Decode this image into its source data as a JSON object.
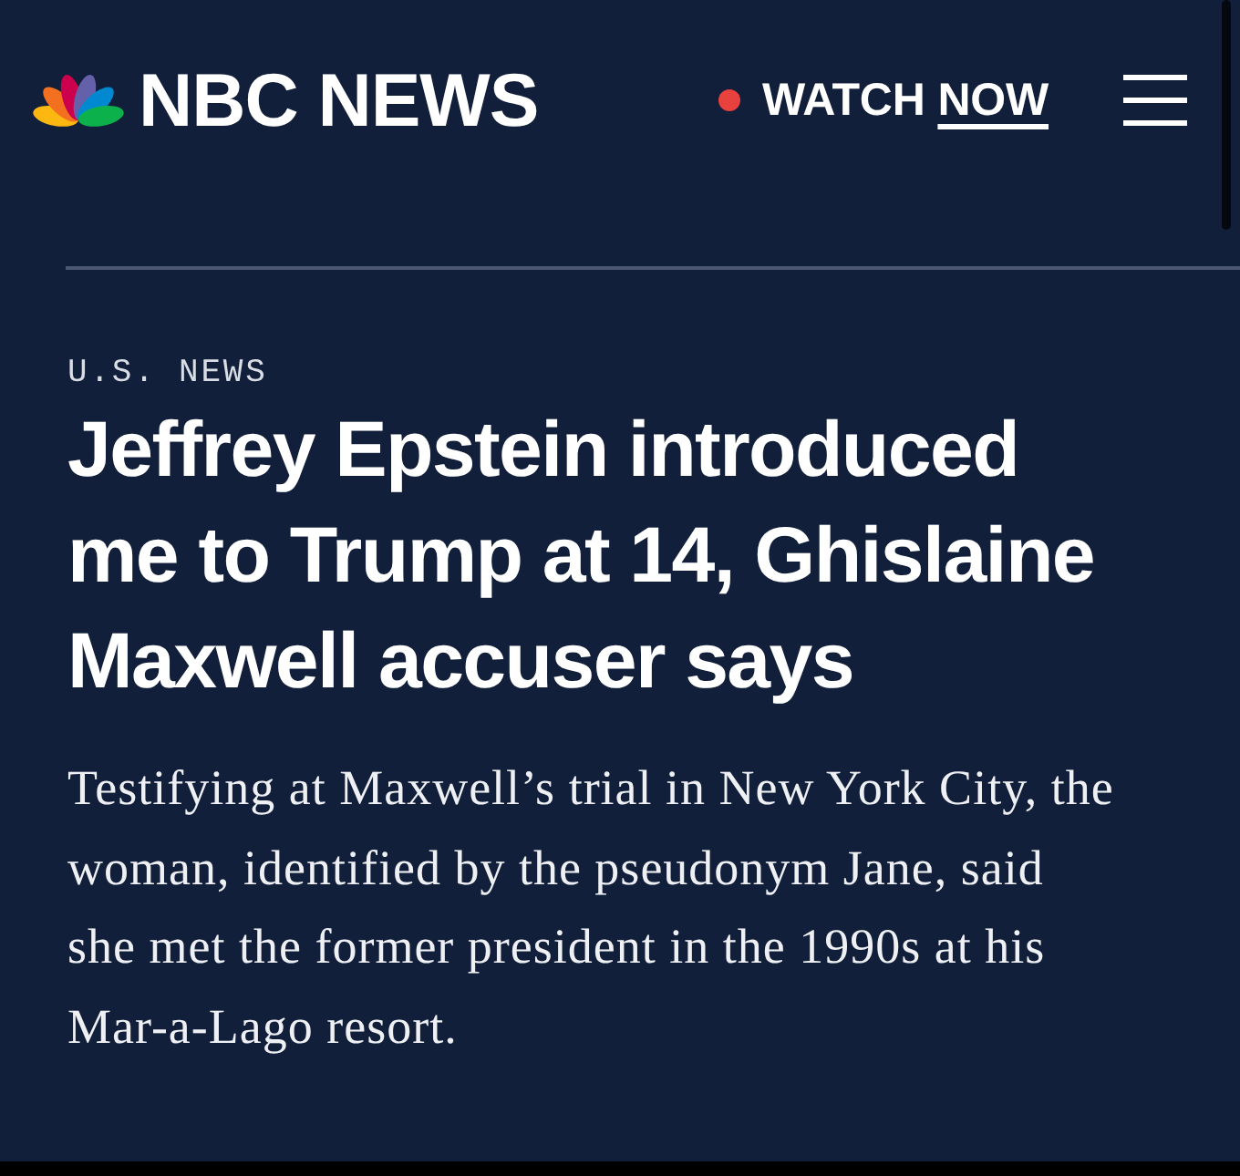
{
  "header": {
    "wordmark": "NBC NEWS",
    "watch_now": {
      "live": true,
      "label": "WATCH",
      "link": "NOW"
    }
  },
  "article": {
    "section": "U.S. NEWS",
    "headline": "Jeffrey Epstein introduced me to Trump at 14, Ghislaine Maxwell accuser says",
    "summary": "Testifying at Maxwell’s trial in New York City, the woman, identified by the pseudonym Jane, said she met the former president in the 1990s at his Mar-a-Lago resort."
  }
}
